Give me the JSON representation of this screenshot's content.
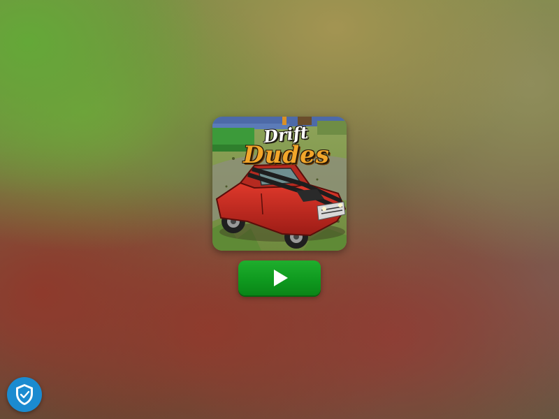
{
  "game": {
    "logo_line1": "Drift",
    "logo_line2": "Dudes",
    "thumbnail_icon": "red-muscle-car-illustration",
    "play_button": {
      "icon": "play-icon",
      "color": "#13a324"
    }
  },
  "privacy_badge": {
    "icon": "shield-check-icon",
    "color": "#1b8bd0"
  }
}
